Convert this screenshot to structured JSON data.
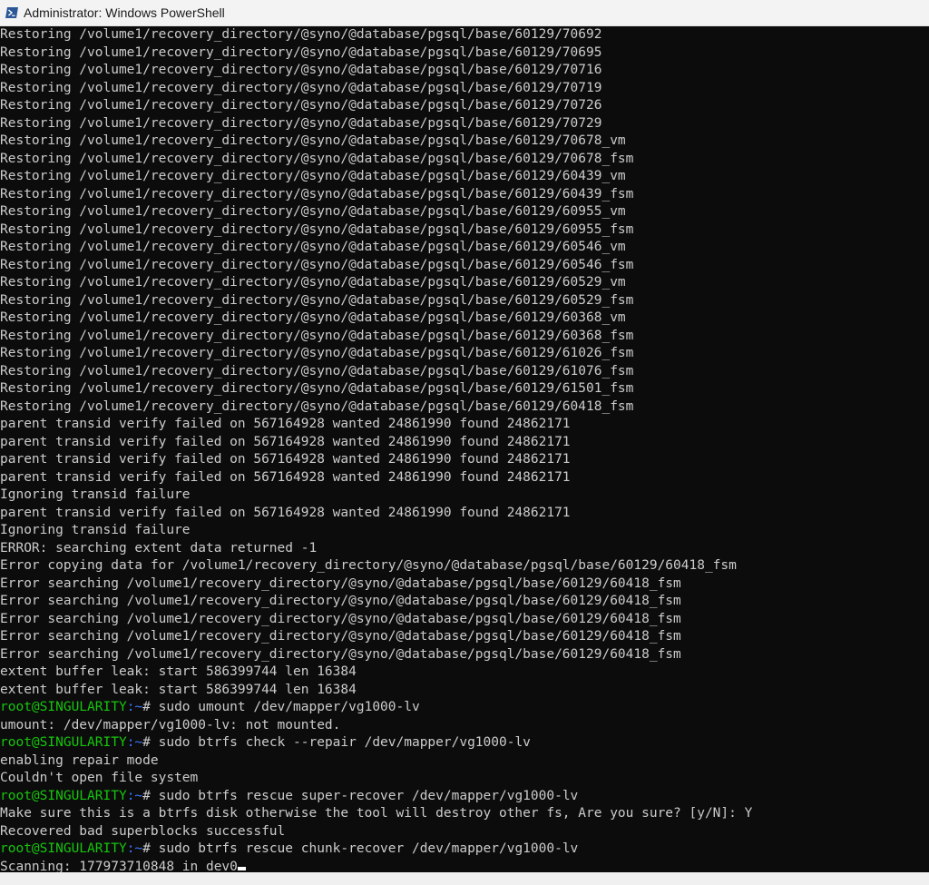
{
  "window": {
    "title": "Administrator: Windows PowerShell",
    "icon": "powershell-icon"
  },
  "colors": {
    "background": "#0c0c0c",
    "text": "#cccccc",
    "prompt_user": "#16c60c",
    "prompt_path": "#3b78ff"
  },
  "console": {
    "lines": [
      {
        "text": "Restoring /volume1/recovery_directory/@syno/@database/pgsql/base/60129/70692"
      },
      {
        "text": "Restoring /volume1/recovery_directory/@syno/@database/pgsql/base/60129/70695"
      },
      {
        "text": "Restoring /volume1/recovery_directory/@syno/@database/pgsql/base/60129/70716"
      },
      {
        "text": "Restoring /volume1/recovery_directory/@syno/@database/pgsql/base/60129/70719"
      },
      {
        "text": "Restoring /volume1/recovery_directory/@syno/@database/pgsql/base/60129/70726"
      },
      {
        "text": "Restoring /volume1/recovery_directory/@syno/@database/pgsql/base/60129/70729"
      },
      {
        "text": "Restoring /volume1/recovery_directory/@syno/@database/pgsql/base/60129/70678_vm"
      },
      {
        "text": "Restoring /volume1/recovery_directory/@syno/@database/pgsql/base/60129/70678_fsm"
      },
      {
        "text": "Restoring /volume1/recovery_directory/@syno/@database/pgsql/base/60129/60439_vm"
      },
      {
        "text": "Restoring /volume1/recovery_directory/@syno/@database/pgsql/base/60129/60439_fsm"
      },
      {
        "text": "Restoring /volume1/recovery_directory/@syno/@database/pgsql/base/60129/60955_vm"
      },
      {
        "text": "Restoring /volume1/recovery_directory/@syno/@database/pgsql/base/60129/60955_fsm"
      },
      {
        "text": "Restoring /volume1/recovery_directory/@syno/@database/pgsql/base/60129/60546_vm"
      },
      {
        "text": "Restoring /volume1/recovery_directory/@syno/@database/pgsql/base/60129/60546_fsm"
      },
      {
        "text": "Restoring /volume1/recovery_directory/@syno/@database/pgsql/base/60129/60529_vm"
      },
      {
        "text": "Restoring /volume1/recovery_directory/@syno/@database/pgsql/base/60129/60529_fsm"
      },
      {
        "text": "Restoring /volume1/recovery_directory/@syno/@database/pgsql/base/60129/60368_vm"
      },
      {
        "text": "Restoring /volume1/recovery_directory/@syno/@database/pgsql/base/60129/60368_fsm"
      },
      {
        "text": "Restoring /volume1/recovery_directory/@syno/@database/pgsql/base/60129/61026_fsm"
      },
      {
        "text": "Restoring /volume1/recovery_directory/@syno/@database/pgsql/base/60129/61076_fsm"
      },
      {
        "text": "Restoring /volume1/recovery_directory/@syno/@database/pgsql/base/60129/61501_fsm"
      },
      {
        "text": "Restoring /volume1/recovery_directory/@syno/@database/pgsql/base/60129/60418_fsm"
      },
      {
        "text": "parent transid verify failed on 567164928 wanted 24861990 found 24862171"
      },
      {
        "text": "parent transid verify failed on 567164928 wanted 24861990 found 24862171"
      },
      {
        "text": "parent transid verify failed on 567164928 wanted 24861990 found 24862171"
      },
      {
        "text": "parent transid verify failed on 567164928 wanted 24861990 found 24862171"
      },
      {
        "text": "Ignoring transid failure"
      },
      {
        "text": "parent transid verify failed on 567164928 wanted 24861990 found 24862171"
      },
      {
        "text": "Ignoring transid failure"
      },
      {
        "text": "ERROR: searching extent data returned -1"
      },
      {
        "text": "Error copying data for /volume1/recovery_directory/@syno/@database/pgsql/base/60129/60418_fsm"
      },
      {
        "text": "Error searching /volume1/recovery_directory/@syno/@database/pgsql/base/60129/60418_fsm"
      },
      {
        "text": "Error searching /volume1/recovery_directory/@syno/@database/pgsql/base/60129/60418_fsm"
      },
      {
        "text": "Error searching /volume1/recovery_directory/@syno/@database/pgsql/base/60129/60418_fsm"
      },
      {
        "text": "Error searching /volume1/recovery_directory/@syno/@database/pgsql/base/60129/60418_fsm"
      },
      {
        "text": "Error searching /volume1/recovery_directory/@syno/@database/pgsql/base/60129/60418_fsm"
      },
      {
        "text": "extent buffer leak: start 586399744 len 16384"
      },
      {
        "text": "extent buffer leak: start 586399744 len 16384"
      },
      {
        "prompt_user": "root@SINGULARITY",
        "prompt_path": ":~",
        "text": "# sudo umount /dev/mapper/vg1000-lv"
      },
      {
        "text": "umount: /dev/mapper/vg1000-lv: not mounted."
      },
      {
        "prompt_user": "root@SINGULARITY",
        "prompt_path": ":~",
        "text": "# sudo btrfs check --repair /dev/mapper/vg1000-lv"
      },
      {
        "text": "enabling repair mode"
      },
      {
        "text": "Couldn't open file system"
      },
      {
        "prompt_user": "root@SINGULARITY",
        "prompt_path": ":~",
        "text": "# sudo btrfs rescue super-recover /dev/mapper/vg1000-lv"
      },
      {
        "text": "Make sure this is a btrfs disk otherwise the tool will destroy other fs, Are you sure? [y/N]: Y"
      },
      {
        "text": "Recovered bad superblocks successful"
      },
      {
        "prompt_user": "root@SINGULARITY",
        "prompt_path": ":~",
        "text": "# sudo btrfs rescue chunk-recover /dev/mapper/vg1000-lv"
      },
      {
        "text": "Scanning: 177973710848 in dev0",
        "cursor": true
      }
    ]
  }
}
